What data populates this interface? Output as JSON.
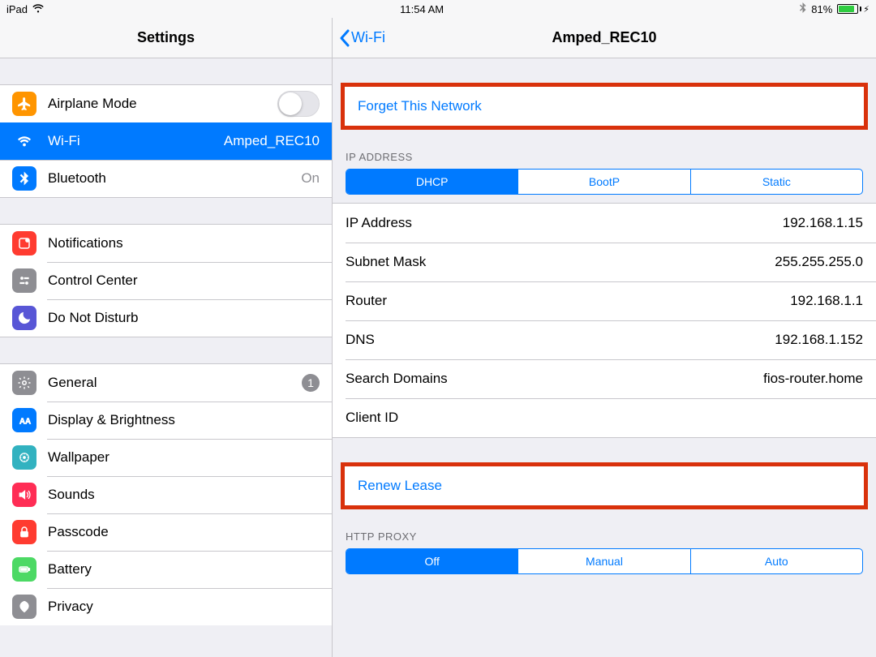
{
  "statusbar": {
    "device": "iPad",
    "time": "11:54 AM",
    "battery_pct": "81%"
  },
  "sidebar": {
    "title": "Settings",
    "groups": [
      {
        "items": [
          {
            "id": "airplane",
            "label": "Airplane Mode",
            "accessory": "switch"
          },
          {
            "id": "wifi",
            "label": "Wi-Fi",
            "value": "Amped_REC10",
            "selected": true
          },
          {
            "id": "bluetooth",
            "label": "Bluetooth",
            "value": "On"
          }
        ]
      },
      {
        "items": [
          {
            "id": "notifications",
            "label": "Notifications"
          },
          {
            "id": "controlcenter",
            "label": "Control Center"
          },
          {
            "id": "dnd",
            "label": "Do Not Disturb"
          }
        ]
      },
      {
        "items": [
          {
            "id": "general",
            "label": "General",
            "badge": "1"
          },
          {
            "id": "display",
            "label": "Display & Brightness"
          },
          {
            "id": "wallpaper",
            "label": "Wallpaper"
          },
          {
            "id": "sounds",
            "label": "Sounds"
          },
          {
            "id": "passcode",
            "label": "Passcode"
          },
          {
            "id": "battery",
            "label": "Battery"
          },
          {
            "id": "privacy",
            "label": "Privacy"
          }
        ]
      }
    ]
  },
  "detail": {
    "back_label": "Wi-Fi",
    "title": "Amped_REC10",
    "forget_label": "Forget This Network",
    "ip_section_header": "IP ADDRESS",
    "ip_tabs": [
      "DHCP",
      "BootP",
      "Static"
    ],
    "ip_tab_active": 0,
    "fields": [
      {
        "k": "IP Address",
        "v": "192.168.1.15"
      },
      {
        "k": "Subnet Mask",
        "v": "255.255.255.0"
      },
      {
        "k": "Router",
        "v": "192.168.1.1"
      },
      {
        "k": "DNS",
        "v": "192.168.1.152"
      },
      {
        "k": "Search Domains",
        "v": "fios-router.home"
      },
      {
        "k": "Client ID",
        "v": ""
      }
    ],
    "renew_label": "Renew Lease",
    "proxy_section_header": "HTTP PROXY",
    "proxy_tabs": [
      "Off",
      "Manual",
      "Auto"
    ],
    "proxy_tab_active": 0
  }
}
